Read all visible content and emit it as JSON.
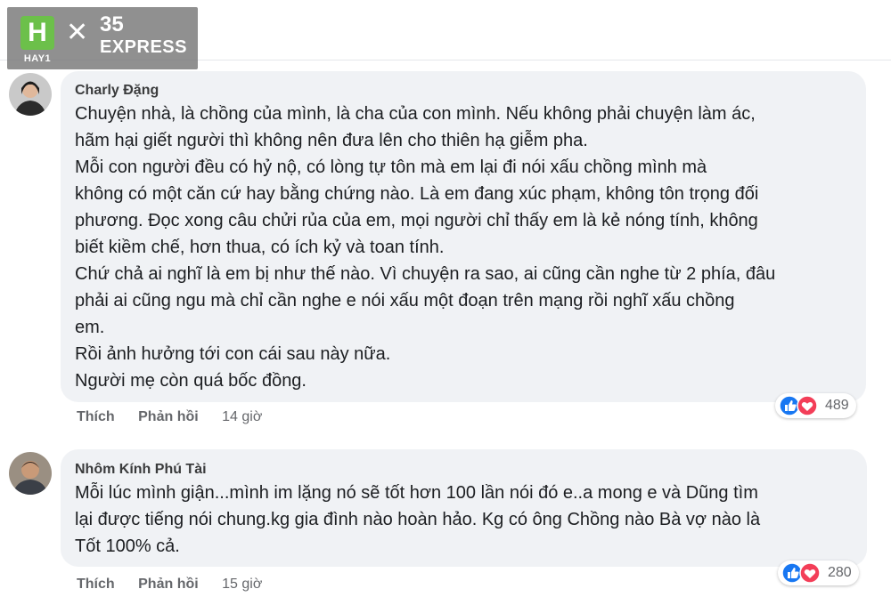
{
  "logo": {
    "h_letter": "H",
    "brand_left": "HAY1",
    "times": "✕",
    "brand_number": "35",
    "brand_word": "EXPRESS"
  },
  "comments": [
    {
      "author": "Charly Đặng",
      "lines": [
        "Chuyện nhà, là chồng của mình, là cha của con mình. Nếu không phải chuyện làm ác,",
        "hãm hại giết người thì không nên đưa lên cho thiên hạ giễm pha.",
        "Mỗi con người đều có hỷ nộ, có lòng tự tôn mà em lại đi nói xấu chồng mình mà",
        "không có một căn cứ hay bằng chứng nào. Là em đang xúc phạm, không tôn trọng đối",
        "phương. Đọc xong câu chửi rủa của em, mọi người chỉ thấy em là kẻ nóng tính, không",
        "biết kiềm chế, hơn thua, có ích kỷ và toan tính.",
        "Chứ chả ai nghĩ là em bị như thế nào. Vì chuyện ra sao, ai cũng cần nghe từ 2 phía, đâu",
        "phải ai cũng ngu mà chỉ cần nghe e nói xấu một đoạn trên mạng rồi nghĩ xấu chồng",
        "em.",
        "Rồi ảnh hưởng tới con cái sau này nữa.",
        "Người mẹ còn quá bốc đồng."
      ],
      "like_label": "Thích",
      "reply_label": "Phản hồi",
      "time": "14 giờ",
      "reaction_count": "489"
    },
    {
      "author": "Nhôm Kính Phú Tài",
      "lines": [
        "Mỗi lúc mình giận...mình im lặng nó sẽ tốt hơn 100 lần nói đó e..a mong e và Dũng tìm",
        "lại được tiếng nói chung.kg gia đình nào hoàn hảo. Kg có ông Chồng nào Bà vợ nào là",
        "Tốt 100% cả."
      ],
      "like_label": "Thích",
      "reply_label": "Phản hồi",
      "time": "15 giờ",
      "reaction_count": "280"
    }
  ]
}
